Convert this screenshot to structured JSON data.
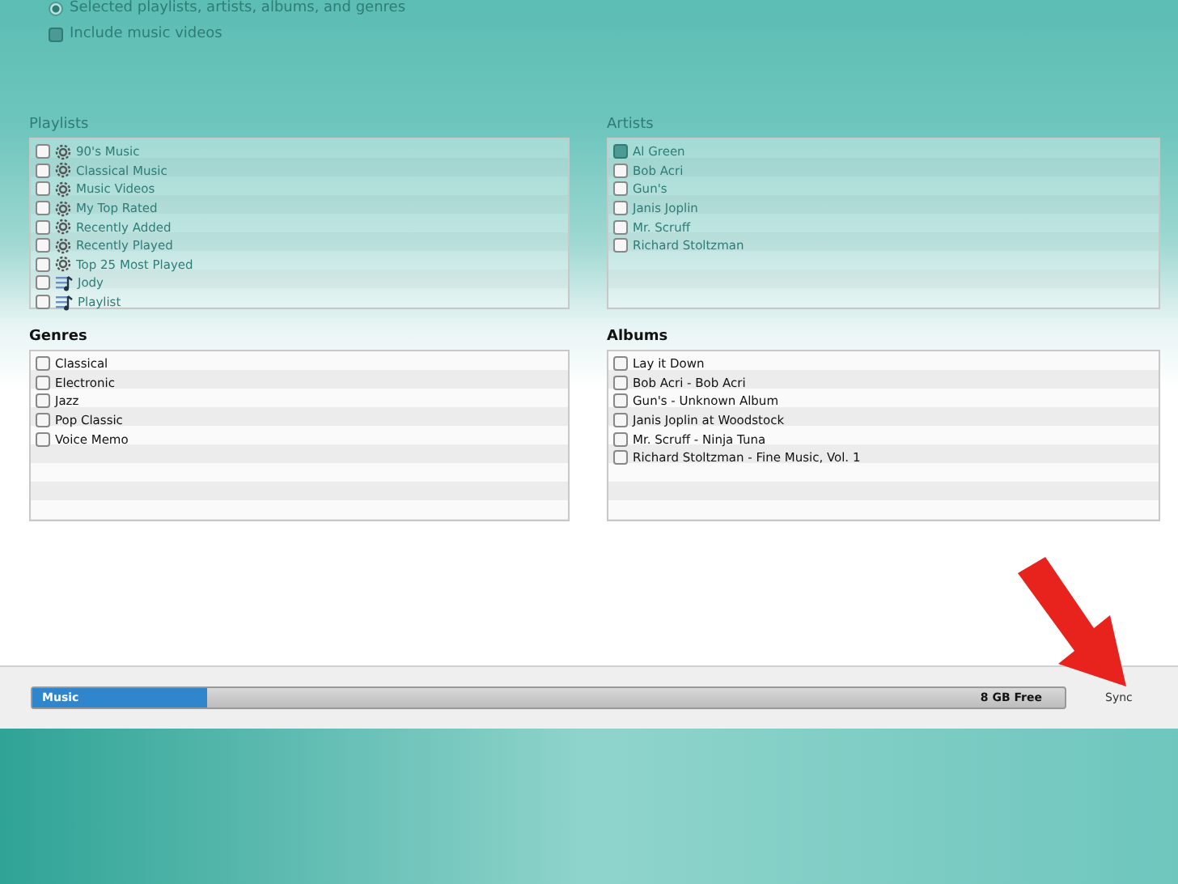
{
  "options": [
    {
      "kind": "radio",
      "label": "Selected playlists, artists, albums, and genres",
      "on": true
    },
    {
      "kind": "checkbox",
      "label": "Include music videos",
      "on": true
    }
  ],
  "panels": [
    {
      "title": "Playlists",
      "faded": true,
      "items": [
        {
          "label": "90's Music",
          "kind": "smart",
          "checked": false
        },
        {
          "label": "Classical Music",
          "kind": "smart",
          "checked": false
        },
        {
          "label": "Music Videos",
          "kind": "smart",
          "checked": false
        },
        {
          "label": "My Top Rated",
          "kind": "smart",
          "checked": false
        },
        {
          "label": "Recently Added",
          "kind": "smart",
          "checked": false
        },
        {
          "label": "Recently Played",
          "kind": "smart",
          "checked": false
        },
        {
          "label": "Top 25 Most Played",
          "kind": "smart",
          "checked": false
        },
        {
          "label": "Jody",
          "kind": "playlist",
          "checked": false
        },
        {
          "label": "Playlist",
          "kind": "playlist",
          "checked": false
        }
      ]
    },
    {
      "title": "Artists",
      "faded": true,
      "items": [
        {
          "label": "Al Green",
          "kind": "plain",
          "checked": true
        },
        {
          "label": "Bob Acri",
          "kind": "plain",
          "checked": false
        },
        {
          "label": "Gun's",
          "kind": "plain",
          "checked": false
        },
        {
          "label": "Janis Joplin",
          "kind": "plain",
          "checked": false
        },
        {
          "label": "Mr. Scruff",
          "kind": "plain",
          "checked": false
        },
        {
          "label": "Richard Stoltzman",
          "kind": "plain",
          "checked": false
        }
      ]
    },
    {
      "title": "Genres",
      "faded": false,
      "items": [
        {
          "label": "Classical",
          "kind": "plain",
          "checked": false
        },
        {
          "label": "Electronic",
          "kind": "plain",
          "checked": false
        },
        {
          "label": "Jazz",
          "kind": "plain",
          "checked": false
        },
        {
          "label": "Pop Classic",
          "kind": "plain",
          "checked": false
        },
        {
          "label": "Voice Memo",
          "kind": "plain",
          "checked": false
        }
      ]
    },
    {
      "title": "Albums",
      "faded": false,
      "items": [
        {
          "label": "Lay it Down",
          "kind": "plain",
          "checked": false
        },
        {
          "label": "Bob Acri - Bob Acri",
          "kind": "plain",
          "checked": false
        },
        {
          "label": "Gun's - Unknown Album",
          "kind": "plain",
          "checked": false
        },
        {
          "label": "Janis Joplin at Woodstock",
          "kind": "plain",
          "checked": false
        },
        {
          "label": "Mr. Scruff - Ninja Tuna",
          "kind": "plain",
          "checked": false
        },
        {
          "label": "Richard Stoltzman - Fine Music, Vol. 1",
          "kind": "plain",
          "checked": false
        }
      ]
    }
  ],
  "capacity": {
    "label": "Music",
    "level": 0.17,
    "free": "8 GB Free"
  },
  "sync_button": "Sync"
}
